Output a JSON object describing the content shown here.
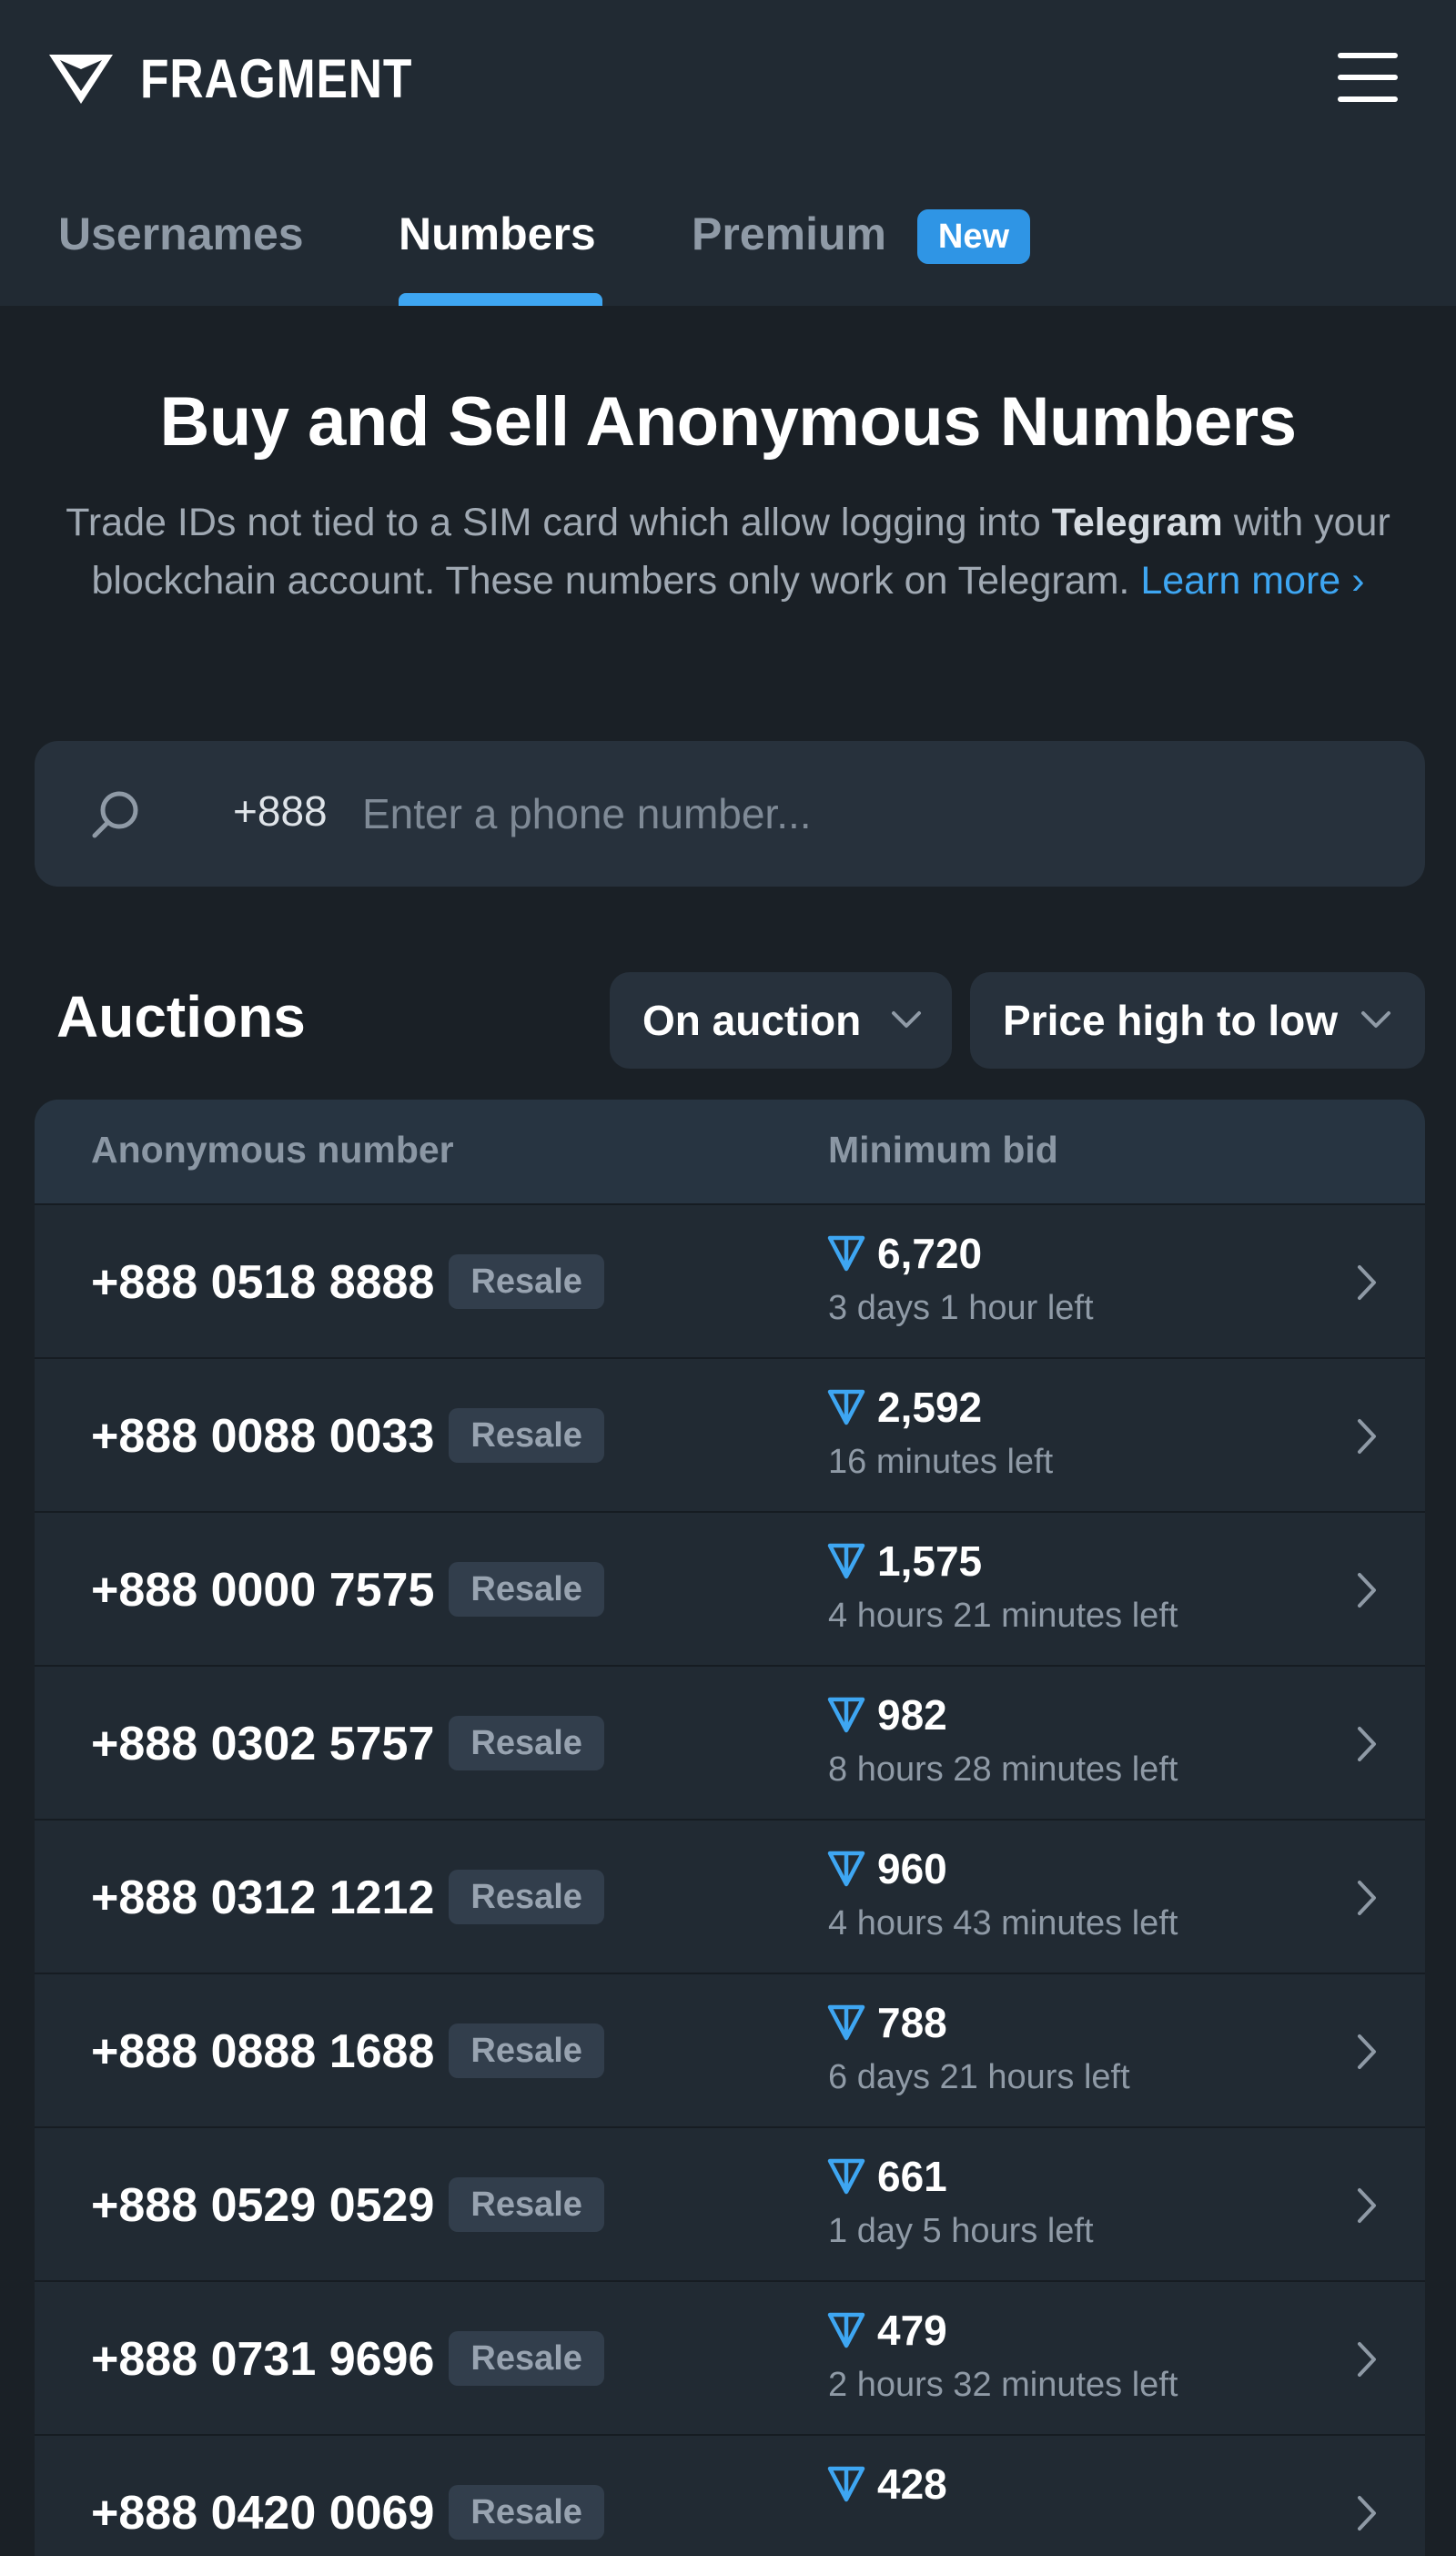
{
  "header": {
    "brand": "FRAGMENT",
    "tabs": [
      "Usernames",
      "Numbers",
      "Premium"
    ],
    "active_tab": "Numbers",
    "new_badge": "New"
  },
  "hero": {
    "title": "Buy and Sell Anonymous Numbers",
    "desc_before": "Trade IDs not tied to a SIM card which allow logging into ",
    "desc_bold": "Telegram",
    "desc_after": " with your blockchain account. These numbers only work on Telegram. ",
    "learn_more": "Learn more",
    "learn_more_arrow": "›"
  },
  "search": {
    "prefix": "+888",
    "placeholder": "Enter a phone number...",
    "value": ""
  },
  "auctions": {
    "title": "Auctions",
    "filter": "On auction",
    "sort": "Price high to low"
  },
  "table": {
    "columns": [
      "Anonymous number",
      "Minimum bid"
    ],
    "rows": [
      {
        "number": "+888 0518 8888",
        "badge": "Resale",
        "bid": "6,720",
        "time": "3 days 1 hour left"
      },
      {
        "number": "+888 0088 0033",
        "badge": "Resale",
        "bid": "2,592",
        "time": "16 minutes left"
      },
      {
        "number": "+888 0000 7575",
        "badge": "Resale",
        "bid": "1,575",
        "time": "4 hours 21 minutes left"
      },
      {
        "number": "+888 0302 5757",
        "badge": "Resale",
        "bid": "982",
        "time": "8 hours 28 minutes left"
      },
      {
        "number": "+888 0312 1212",
        "badge": "Resale",
        "bid": "960",
        "time": "4 hours 43 minutes left"
      },
      {
        "number": "+888 0888 1688",
        "badge": "Resale",
        "bid": "788",
        "time": "6 days 21 hours left"
      },
      {
        "number": "+888 0529 0529",
        "badge": "Resale",
        "bid": "661",
        "time": "1 day 5 hours left"
      },
      {
        "number": "+888 0731 9696",
        "badge": "Resale",
        "bid": "479",
        "time": "2 hours 32 minutes left"
      },
      {
        "number": "+888 0420 0069",
        "badge": "Resale",
        "bid": "428",
        "time": ""
      }
    ]
  },
  "colors": {
    "header_bg": "#212a33",
    "page_bg": "#1a2026",
    "accent": "#3ea6f2",
    "ton_icon": "#3ea6f2"
  },
  "icons": {
    "logo": "fragment-logo-icon",
    "menu": "hamburger-menu-icon",
    "search": "search-icon",
    "dropdown": "chevron-down-icon",
    "currency": "ton-icon",
    "row_arrow": "chevron-right-icon"
  }
}
